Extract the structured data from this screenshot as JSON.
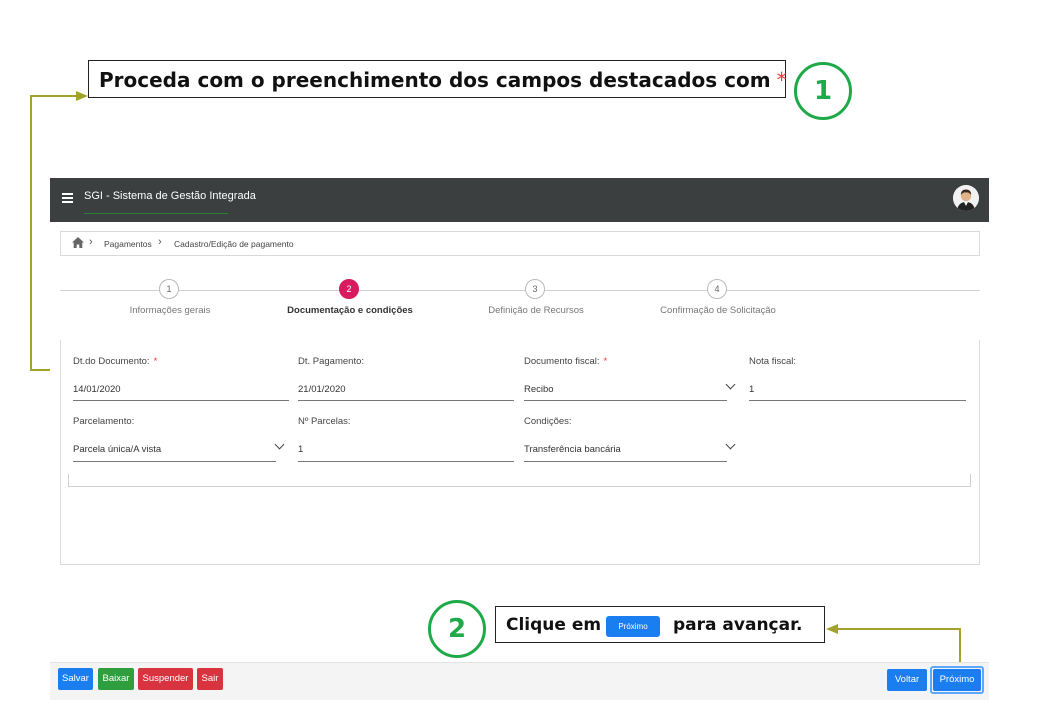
{
  "callout1": {
    "text": "Proceda com o preenchimento dos campos destacados com",
    "star": "*",
    "step": "1"
  },
  "app": {
    "title": "SGI - Sistema de Gestão Integrada"
  },
  "breadcrumb": {
    "items": [
      "Pagamentos",
      "Cadastro/Edição de pagamento"
    ]
  },
  "stepper": {
    "steps": [
      {
        "num": "1",
        "label": "Informações gerais",
        "active": false
      },
      {
        "num": "2",
        "label": "Documentação e condições",
        "active": true
      },
      {
        "num": "3",
        "label": "Definição de Recursos",
        "active": false
      },
      {
        "num": "4",
        "label": "Confirmação de Solicitação",
        "active": false
      }
    ]
  },
  "form": {
    "dt_documento": {
      "label": "Dt.do Documento:",
      "required": "*",
      "value": "14/01/2020"
    },
    "dt_pagamento": {
      "label": "Dt. Pagamento:",
      "value": "21/01/2020"
    },
    "documento_fiscal": {
      "label": "Documento fiscal:",
      "required": "*",
      "value": "Recibo"
    },
    "nota_fiscal": {
      "label": "Nota fiscal:",
      "value": "1"
    },
    "parcelamento": {
      "label": "Parcelamento:",
      "value": "Parcela única/A vista"
    },
    "n_parcelas": {
      "label": "Nº Parcelas:",
      "value": "1"
    },
    "condicoes": {
      "label": "Condições:",
      "value": "Transferência bancária"
    }
  },
  "callout2": {
    "prefix": "Clique em",
    "button": "Próximo",
    "suffix": "para avançar.",
    "step": "2"
  },
  "footer": {
    "salvar": "Salvar",
    "baixar": "Baixar",
    "suspender": "Suspender",
    "sair": "Sair",
    "voltar": "Voltar",
    "proximo": "Próximo"
  },
  "colors": {
    "accent_green": "#1faa4a",
    "active_step": "#d81b60",
    "primary": "#1a7ef0",
    "danger": "#d9333f",
    "success": "#2e9e3f",
    "arrow": "#a3a32a"
  }
}
